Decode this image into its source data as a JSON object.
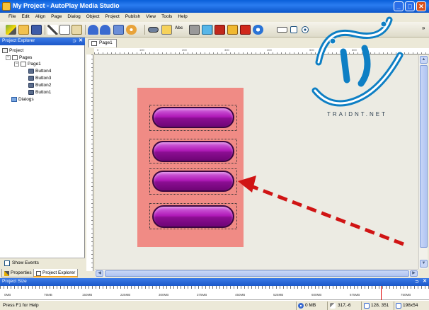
{
  "window": {
    "title": "My Project - AutoPlay Media Studio",
    "minimize_glyph": "_",
    "maximize_glyph": "□",
    "close_glyph": "✕"
  },
  "menu": {
    "items": [
      "File",
      "Edit",
      "Align",
      "Page",
      "Dialog",
      "Object",
      "Project",
      "Publish",
      "View",
      "Tools",
      "Help"
    ]
  },
  "toolbar": {
    "abc_label": "Abc",
    "overflow_glyph": "»",
    "icons": [
      "magic-wand-icon",
      "open-folder-icon",
      "save-icon",
      "cut-icon",
      "copy-icon",
      "paste-icon",
      "undo-icon",
      "redo-icon",
      "preview-icon",
      "publish-icon",
      "button-object-icon",
      "image-object-icon",
      "label-object-icon",
      "plugin-object-icon",
      "web-object-icon",
      "flash-object-icon",
      "slideshow-object-icon",
      "pdf-object-icon",
      "ie-object-icon",
      "input-object-icon",
      "checkbox-object-icon",
      "radio-object-icon"
    ]
  },
  "project_explorer": {
    "title": "Project Explorer",
    "pin_glyph": "⊃",
    "close_glyph": "✕",
    "tree": {
      "root": "Project",
      "pages": "Pages",
      "page1": "Page1",
      "buttons": [
        "Button4",
        "Button3",
        "Button2",
        "Button1"
      ],
      "dialogs": "Dialogs"
    },
    "expander_minus": "−",
    "show_events": "Show Events",
    "tabs": {
      "properties": "Properties",
      "explorer": "Project Explorer"
    }
  },
  "document": {
    "tab_label": "Page1",
    "page_color": "#f08b85",
    "button_color": "#b01ab8",
    "buttons": [
      "Button1",
      "Button2",
      "Button3",
      "Button4"
    ],
    "arrow_color": "#d01414",
    "ruler_labels": [
      "0",
      "100",
      "200",
      "300",
      "400",
      "500",
      "600"
    ]
  },
  "project_size": {
    "title": "Project Size",
    "ticks": [
      "0MB",
      "75MB",
      "150MB",
      "225MB",
      "300MB",
      "375MB",
      "450MB",
      "525MB",
      "600MB",
      "675MB",
      "750MB"
    ]
  },
  "status": {
    "help": "Press F1 for Help",
    "size": "0 MB",
    "position": "317,-6",
    "coords": "128, 351",
    "dimensions": "198x54"
  },
  "watermark": {
    "brand": "TRAIDNT.NET"
  }
}
